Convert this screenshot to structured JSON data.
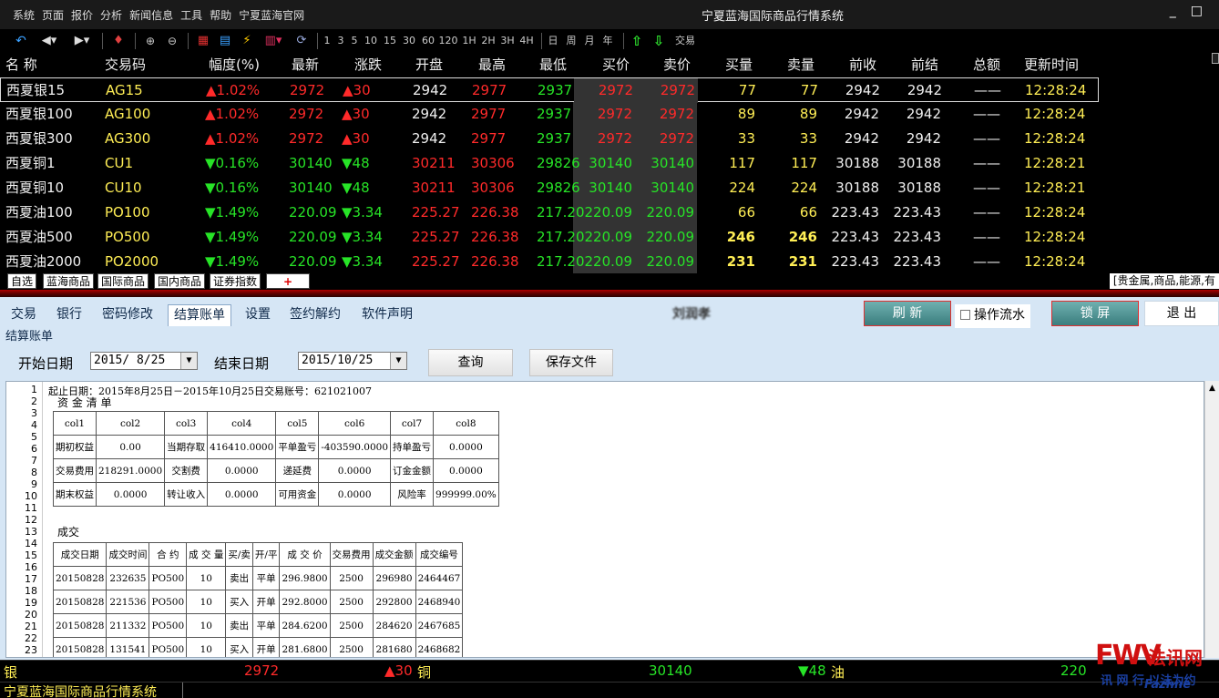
{
  "menubar": {
    "menus": [
      "系统",
      "页面",
      "报价",
      "分析",
      "新闻信息",
      "工具",
      "帮助",
      "宁夏蓝海官网"
    ],
    "title": "宁夏蓝海国际商品行情系统",
    "controls": [
      "_",
      "□"
    ]
  },
  "toolbar": {
    "periods": [
      "1",
      "3",
      "5",
      "10",
      "15",
      "30",
      "60",
      "120",
      "1H",
      "2H",
      "3H",
      "4H"
    ],
    "cycles": [
      "日",
      "周",
      "月",
      "年"
    ],
    "trade_label": "交易"
  },
  "quotes": {
    "headers": [
      "名  称",
      "交易码",
      "幅度(%)",
      "最新",
      "涨跌",
      "开盘",
      "最高",
      "最低",
      "买价",
      "卖价",
      "买量",
      "卖量",
      "前收",
      "前结",
      "总额",
      "更新时间"
    ],
    "rows": [
      {
        "name": "西夏银15",
        "code": "AG15",
        "pct": "▲1.02%",
        "last": "2972",
        "chg": "▲30",
        "open": "2942",
        "high": "2977",
        "low": "2937",
        "bid": "2972",
        "ask": "2972",
        "bidvol": "77",
        "askvol": "77",
        "prevclose": "2942",
        "prevsettle": "2942",
        "amount": "——",
        "time": "12:28:24",
        "dir": "up",
        "bold": false
      },
      {
        "name": "西夏银100",
        "code": "AG100",
        "pct": "▲1.02%",
        "last": "2972",
        "chg": "▲30",
        "open": "2942",
        "high": "2977",
        "low": "2937",
        "bid": "2972",
        "ask": "2972",
        "bidvol": "89",
        "askvol": "89",
        "prevclose": "2942",
        "prevsettle": "2942",
        "amount": "——",
        "time": "12:28:24",
        "dir": "up",
        "bold": false
      },
      {
        "name": "西夏银300",
        "code": "AG300",
        "pct": "▲1.02%",
        "last": "2972",
        "chg": "▲30",
        "open": "2942",
        "high": "2977",
        "low": "2937",
        "bid": "2972",
        "ask": "2972",
        "bidvol": "33",
        "askvol": "33",
        "prevclose": "2942",
        "prevsettle": "2942",
        "amount": "——",
        "time": "12:28:24",
        "dir": "up",
        "bold": false
      },
      {
        "name": "西夏铜1",
        "code": "CU1",
        "pct": "▼0.16%",
        "last": "30140",
        "chg": "▼48",
        "open": "30211",
        "high": "30306",
        "low": "29826",
        "bid": "30140",
        "ask": "30140",
        "bidvol": "117",
        "askvol": "117",
        "prevclose": "30188",
        "prevsettle": "30188",
        "amount": "——",
        "time": "12:28:21",
        "dir": "dn",
        "bold": false
      },
      {
        "name": "西夏铜10",
        "code": "CU10",
        "pct": "▼0.16%",
        "last": "30140",
        "chg": "▼48",
        "open": "30211",
        "high": "30306",
        "low": "29826",
        "bid": "30140",
        "ask": "30140",
        "bidvol": "224",
        "askvol": "224",
        "prevclose": "30188",
        "prevsettle": "30188",
        "amount": "——",
        "time": "12:28:21",
        "dir": "dn",
        "bold": false
      },
      {
        "name": "西夏油100",
        "code": "PO100",
        "pct": "▼1.49%",
        "last": "220.09",
        "chg": "▼3.34",
        "open": "225.27",
        "high": "226.38",
        "low": "217.20",
        "bid": "220.09",
        "ask": "220.09",
        "bidvol": "66",
        "askvol": "66",
        "prevclose": "223.43",
        "prevsettle": "223.43",
        "amount": "——",
        "time": "12:28:24",
        "dir": "dn",
        "bold": false
      },
      {
        "name": "西夏油500",
        "code": "PO500",
        "pct": "▼1.49%",
        "last": "220.09",
        "chg": "▼3.34",
        "open": "225.27",
        "high": "226.38",
        "low": "217.20",
        "bid": "220.09",
        "ask": "220.09",
        "bidvol": "246",
        "askvol": "246",
        "prevclose": "223.43",
        "prevsettle": "223.43",
        "amount": "——",
        "time": "12:28:24",
        "dir": "dn",
        "bold": true
      },
      {
        "name": "西夏油2000",
        "code": "PO2000",
        "pct": "▼1.49%",
        "last": "220.09",
        "chg": "▼3.34",
        "open": "225.27",
        "high": "226.38",
        "low": "217.20",
        "bid": "220.09",
        "ask": "220.09",
        "bidvol": "231",
        "askvol": "231",
        "prevclose": "223.43",
        "prevsettle": "223.43",
        "amount": "——",
        "time": "12:28:24",
        "dir": "dn",
        "bold": true
      }
    ]
  },
  "market_tabs": [
    "自选",
    "蓝海商品",
    "国际商品",
    "国内商品",
    "证券指数",
    "+"
  ],
  "market_info": "[贵金属,商品,能源,有",
  "panel": {
    "tabs": [
      "交易",
      "银行",
      "密码修改",
      "结算账单",
      "设置",
      "签约解约",
      "软件声明"
    ],
    "active_tab": "结算账单",
    "user": "刘润孝",
    "refresh_label": "刷 新",
    "flow_label": "操作流水",
    "lock_label": "锁 屏",
    "exit_label": "退 出",
    "section_title": "结算账单",
    "start_label": "开始日期",
    "start_value": "2015/ 8/25",
    "end_label": "结束日期",
    "end_value": "2015/10/25",
    "query_label": "查询",
    "save_label": "保存文件"
  },
  "report": {
    "line_numbers": [
      "1",
      "2",
      "3",
      "4",
      "5",
      "6",
      "7",
      "8",
      "9",
      "10",
      "11",
      "12",
      "13",
      "14",
      "15",
      "16",
      "17",
      "18",
      "19",
      "20",
      "21",
      "22",
      "23"
    ],
    "header_line": "起止日期：2015年8月25日－2015年10月25日交易账号：621021007",
    "funds_title": "资 金 清 单",
    "funds_cols": [
      "col1",
      "col2",
      "col3",
      "col4",
      "col5",
      "col6",
      "col7",
      "col8"
    ],
    "funds_rows": [
      [
        "期初权益",
        "0.00",
        "当期存取",
        "416410.0000",
        "平单盈亏",
        "-403590.0000",
        "持单盈亏",
        "0.0000"
      ],
      [
        "交易费用",
        "218291.0000",
        "交割费",
        "0.0000",
        "递延费",
        "0.0000",
        "订金金额",
        "0.0000"
      ],
      [
        "期末权益",
        "0.0000",
        "转让收入",
        "0.0000",
        "可用资金",
        "0.0000",
        "风险率",
        "999999.00%"
      ]
    ],
    "trades_title": "成交",
    "trades_cols": [
      "成交日期",
      "成交时间",
      "合  约",
      "成 交 量",
      "买/卖",
      "开/平",
      "成 交 价",
      "交易费用",
      "成交金额",
      "成交编号"
    ],
    "trades_rows": [
      [
        "20150828",
        "232635",
        "PO500",
        "10",
        "卖出",
        "平单",
        "296.9800",
        "2500",
        "296980",
        "2464467"
      ],
      [
        "20150828",
        "221536",
        "PO500",
        "10",
        "买入",
        "开单",
        "292.8000",
        "2500",
        "292800",
        "2468940"
      ],
      [
        "20150828",
        "211332",
        "PO500",
        "10",
        "卖出",
        "平单",
        "284.6200",
        "2500",
        "284620",
        "2467685"
      ],
      [
        "20150828",
        "131541",
        "PO500",
        "10",
        "买入",
        "开单",
        "281.6800",
        "2500",
        "281680",
        "2468682"
      ]
    ]
  },
  "ticker": [
    {
      "name": "银",
      "price": "2972",
      "chg": "▲30",
      "dir": "up"
    },
    {
      "name": "铜",
      "price": "30140",
      "chg": "▼48",
      "dir": "dn"
    },
    {
      "name": "油",
      "price": "220",
      "chg": "",
      "dir": "dn"
    }
  ],
  "status": "宁夏蓝海国际商品行情系统",
  "watermark": {
    "logo": "FWV",
    "brand": "法讯网",
    "line1": "讯 网 行  以法为约",
    "line2": "Fazhne"
  },
  "colors": {
    "up": "#ff2a2a",
    "down": "#27e427",
    "volume": "#ffee55",
    "panel_bg": "#d6e6f5"
  }
}
